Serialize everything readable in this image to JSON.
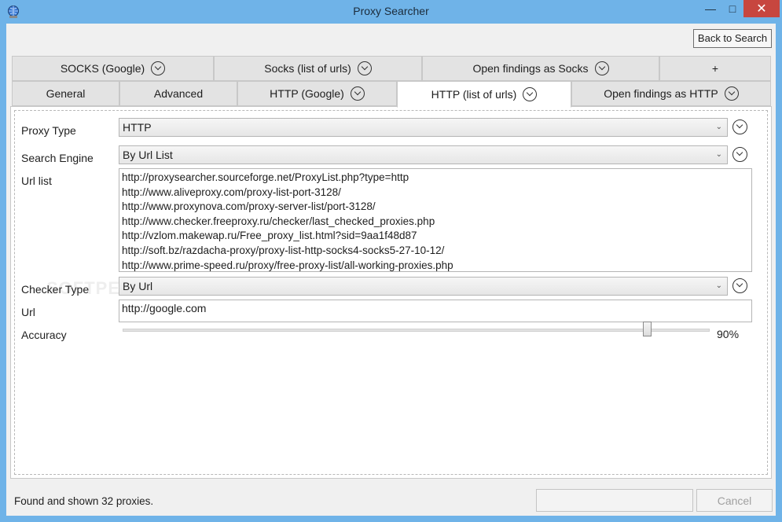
{
  "window": {
    "title": "Proxy Searcher"
  },
  "toolbar": {
    "back_label": "Back to Search"
  },
  "tabs_row1": [
    {
      "label": "SOCKS (Google)",
      "has_menu": true
    },
    {
      "label": "Socks (list of urls)",
      "has_menu": true
    },
    {
      "label": "Open findings as Socks",
      "has_menu": true
    },
    {
      "label": "+",
      "has_menu": false
    }
  ],
  "tabs_row2": [
    {
      "label": "General",
      "has_menu": false
    },
    {
      "label": "Advanced",
      "has_menu": false
    },
    {
      "label": "HTTP (Google)",
      "has_menu": true
    },
    {
      "label": "HTTP (list of urls)",
      "has_menu": true,
      "active": true
    },
    {
      "label": "Open findings as HTTP",
      "has_menu": true
    }
  ],
  "form": {
    "proxy_type": {
      "label": "Proxy Type",
      "value": "HTTP"
    },
    "search_engine": {
      "label": "Search Engine",
      "value": "By Url List"
    },
    "url_list": {
      "label": "Url list",
      "items": [
        "http://proxysearcher.sourceforge.net/ProxyList.php?type=http",
        "http://www.aliveproxy.com/proxy-list-port-3128/",
        "http://www.proxynova.com/proxy-server-list/port-3128/",
        "http://www.checker.freeproxy.ru/checker/last_checked_proxies.php",
        "http://vzlom.makewap.ru/Free_proxy_list.html?sid=9aa1f48d87",
        "http://soft.bz/razdacha-proxy/proxy-list-http-socks4-socks5-27-10-12/",
        "http://www.prime-speed.ru/proxy/free-proxy-list/all-working-proxies.php"
      ]
    },
    "checker_type": {
      "label": "Checker Type",
      "value": "By Url"
    },
    "url": {
      "label": "Url",
      "value": "http://google.com"
    },
    "accuracy": {
      "label": "Accuracy",
      "value": 90,
      "display": "90%"
    }
  },
  "watermark": "SOFTPEDIA",
  "status": {
    "message": "Found and shown 32 proxies.",
    "blank_label": "",
    "cancel_label": "Cancel"
  }
}
